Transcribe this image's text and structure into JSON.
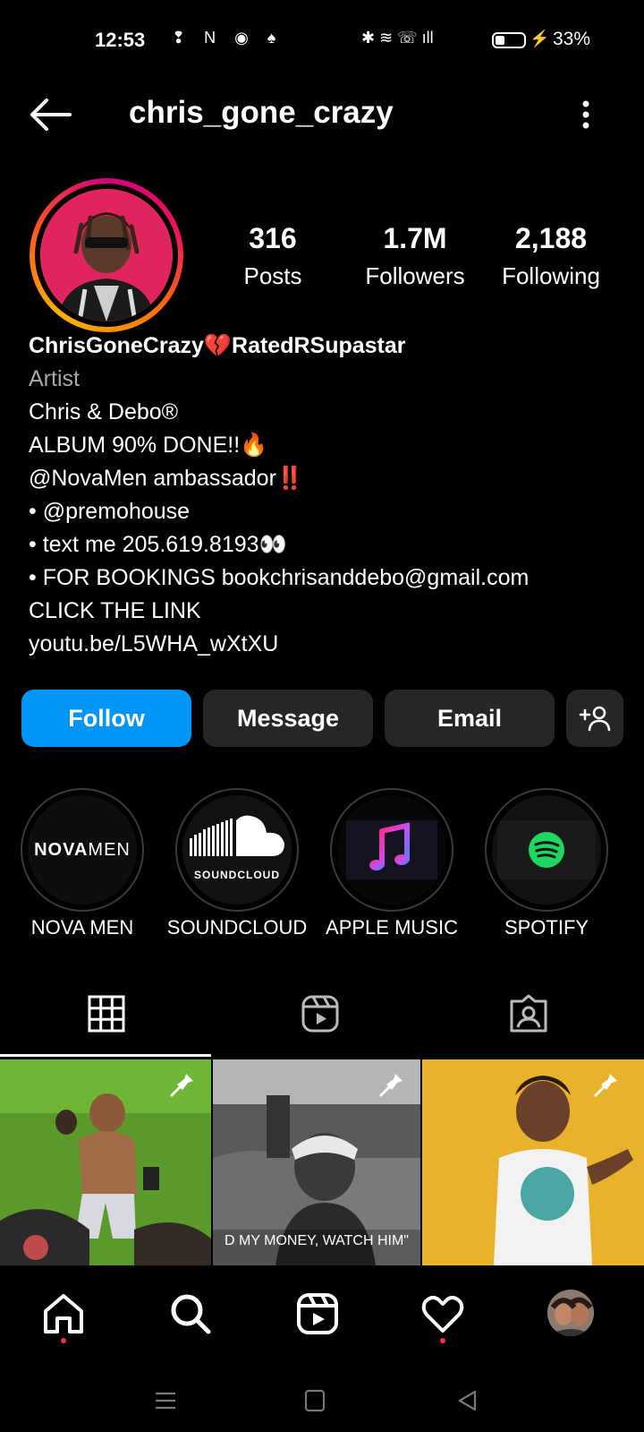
{
  "status_bar": {
    "time": "12:53",
    "left_icons": "❢ N ◉ ♠",
    "right_icons": "✱ ≋ ☏ ıll",
    "battery_level": 0.33,
    "battery_percent": "33%"
  },
  "header": {
    "username": "chris_gone_crazy"
  },
  "stats": {
    "posts": {
      "value": "316",
      "label": "Posts"
    },
    "followers": {
      "value": "1.7M",
      "label": "Followers"
    },
    "following": {
      "value": "2,188",
      "label": "Following"
    }
  },
  "bio": {
    "name": "ChrisGoneCrazy💔RatedRSupastar",
    "category": "Artist",
    "lines": [
      "Chris & Debo®",
      "ALBUM 90% DONE!!🔥",
      "@NovaMen ambassador‼️",
      "• @premohouse",
      "• text me 205.619.8193👀",
      "• FOR BOOKINGS bookchrisanddebo@gmail.com",
      "CLICK THE LINK"
    ],
    "link": "youtu.be/L5WHA_wXtXU"
  },
  "actions": {
    "follow": "Follow",
    "message": "Message",
    "email": "Email"
  },
  "highlights": [
    {
      "label": "NOVA MEN",
      "cover_text_a": "NOVA",
      "cover_text_b": "MEN"
    },
    {
      "label": "SOUNDCLOUD",
      "cover_text": "SOUNDCLOUD"
    },
    {
      "label": "APPLE MUSIC"
    },
    {
      "label": "SPOTIFY"
    }
  ],
  "posts": [
    {
      "pinned": true
    },
    {
      "pinned": true,
      "caption": "D MY MONEY, WATCH HIM\""
    },
    {
      "pinned": true
    }
  ],
  "colors": {
    "follow_button": "#0095f6",
    "button_bg": "#262626",
    "notification_dot": "#ff3040"
  }
}
